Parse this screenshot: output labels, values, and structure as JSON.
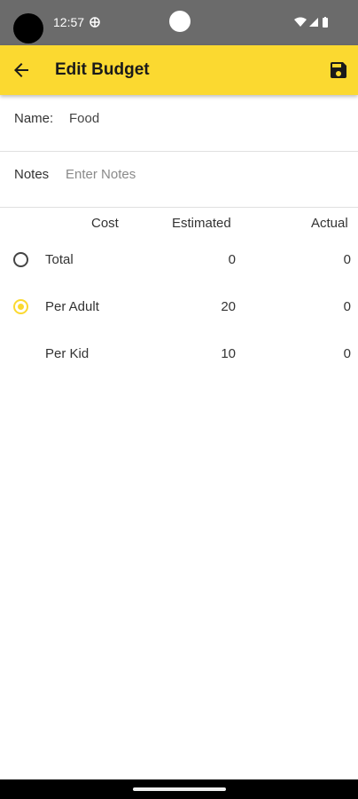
{
  "status_bar": {
    "time": "12:57"
  },
  "app_bar": {
    "title": "Edit Budget",
    "accent_color": "#fbd930"
  },
  "form": {
    "name_label": "Name:",
    "name_value": "Food",
    "notes_label": "Notes",
    "notes_placeholder": "Enter Notes",
    "notes_value": ""
  },
  "table": {
    "headers": {
      "cost": "Cost",
      "estimated": "Estimated",
      "actual": "Actual"
    },
    "rows": [
      {
        "label": "Total",
        "estimated": "0",
        "actual": "0",
        "radio": "unselected"
      },
      {
        "label": "Per Adult",
        "estimated": "20",
        "actual": "0",
        "radio": "selected"
      },
      {
        "label": "Per Kid",
        "estimated": "10",
        "actual": "0",
        "radio": "none"
      }
    ]
  }
}
